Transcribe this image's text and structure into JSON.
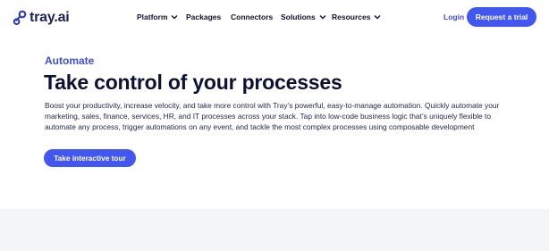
{
  "brand": {
    "name": "tray.ai"
  },
  "nav": {
    "items": [
      {
        "label": "Platform",
        "has_dropdown": true
      },
      {
        "label": "Packages",
        "has_dropdown": false
      },
      {
        "label": "Connectors",
        "has_dropdown": false
      },
      {
        "label": "Solutions",
        "has_dropdown": true
      },
      {
        "label": "Resources",
        "has_dropdown": true
      }
    ],
    "login_label": "Login",
    "trial_label": "Request a trial"
  },
  "hero": {
    "eyebrow": "Automate",
    "title": "Take control of your processes",
    "body": "Boost your productivity, increase velocity, and take more control with Tray’s powerful, easy-to-manage automation. Quickly automate your marketing, sales, finance, services, HR, and IT processes across your stack. Tap into low-code business logic that’s uniquely flexible to automate any process, trigger automations on any event, and tackle the most complex processes using composable development",
    "cta_label": "Take interactive tour"
  },
  "colors": {
    "accent": "#4257f0",
    "eyebrow": "#3f4fd8",
    "heading": "#0d1133",
    "band": "#f4f5f7"
  },
  "icons": {
    "logo": "tray-logo-icon",
    "dropdown": "chevron-down-icon"
  }
}
